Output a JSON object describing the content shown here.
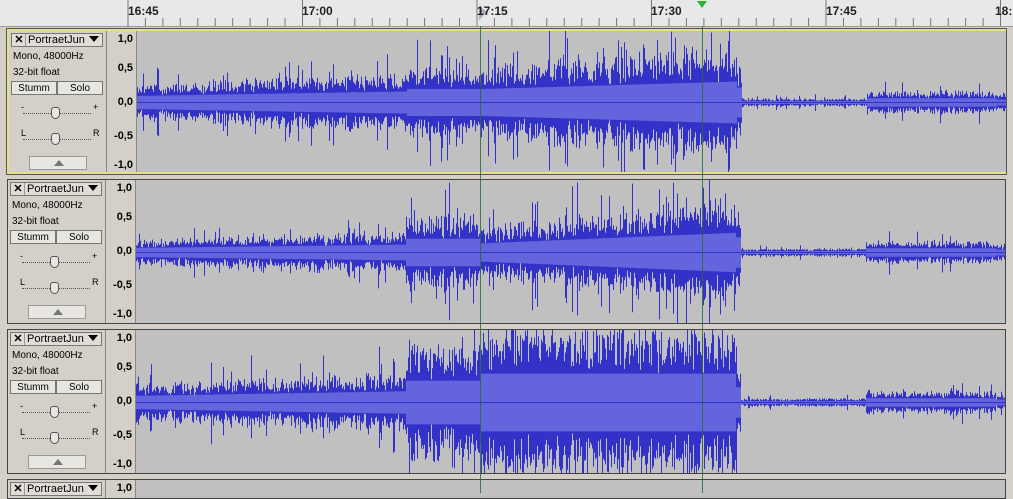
{
  "ruler": {
    "ticks": [
      "16:45",
      "17:00",
      "17:15",
      "17:30",
      "17:45",
      "18:"
    ]
  },
  "tracks": [
    {
      "name": "PortraetJun",
      "format": "Mono, 48000Hz",
      "bitdepth": "32-bit float",
      "mute_label": "Stumm",
      "solo_label": "Solo",
      "gain_minus": "-",
      "gain_plus": "+",
      "pan_left": "L",
      "pan_right": "R",
      "selected": true
    },
    {
      "name": "PortraetJun",
      "format": "Mono, 48000Hz",
      "bitdepth": "32-bit float",
      "mute_label": "Stumm",
      "solo_label": "Solo",
      "gain_minus": "-",
      "gain_plus": "+",
      "pan_left": "L",
      "pan_right": "R",
      "selected": false
    },
    {
      "name": "PortraetJun",
      "format": "Mono, 48000Hz",
      "bitdepth": "32-bit float",
      "mute_label": "Stumm",
      "solo_label": "Solo",
      "gain_minus": "-",
      "gain_plus": "+",
      "pan_left": "L",
      "pan_right": "R",
      "selected": false
    },
    {
      "name": "PortraetJun",
      "selected": false
    }
  ],
  "amplitude_labels": [
    "1,0",
    "0,5",
    "0,0",
    "-0,5",
    "-1,0"
  ],
  "partial_amplitude_label": "1,0",
  "colors": {
    "waveform": "#3232c8",
    "waveform_rms": "#6464dc",
    "waveform_bg": "#c0c0c0",
    "selected_border": "#e6e08a",
    "play_marker": "#2db52d"
  }
}
